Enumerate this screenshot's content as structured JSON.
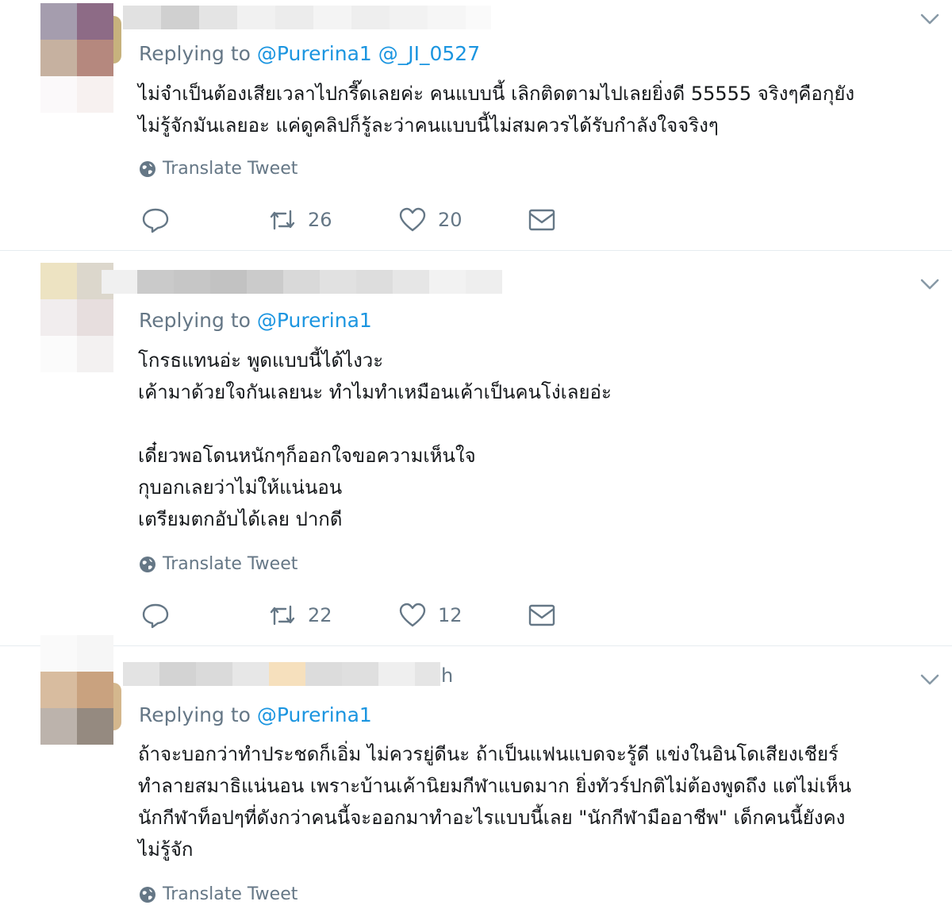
{
  "colors": {
    "link": "#1b95e0",
    "muted": "#657786",
    "text": "#14171a",
    "divider": "#e6ecf0"
  },
  "icons": {
    "more": "chevron-down-icon",
    "translate": "globe-icon",
    "reply": "reply-icon",
    "retweet": "retweet-icon",
    "like": "heart-icon",
    "dm": "envelope-icon"
  },
  "tweets": [
    {
      "replying_prefix": "Replying to",
      "mentions": [
        "@Purerina1",
        "@_JI_0527"
      ],
      "text": "ไม่จำเป็นต้องเสียเวลาไปกรี๊ดเลยค่ะ คนแบบนี้ เลิกติดตามไปเลยยิ่งดี 55555 จริงๆคือกุยัง\nไม่รู้จักมันเลยอะ แค่ดูคลิปก็รู้ละว่าคนแบบนี้ไม่สมควรได้รับกำลังใจจริงๆ",
      "translate_label": "Translate Tweet",
      "retweets": "26",
      "likes": "20"
    },
    {
      "replying_prefix": "Replying to",
      "mentions": [
        "@Purerina1"
      ],
      "text": "โกรธแทนอ่ะ พูดแบบนี้ได้ไงวะ\nเค้ามาด้วยใจกันเลยนะ ทำไมทำเหมือนเค้าเป็นคนโง่เลยอ่ะ\n\nเดี๋ยวพอโดนหนักๆก็ออกใจขอความเห็นใจ\nกุบอกเลยว่าไม่ให้แน่นอน\nเตรียมตกอับได้เลย ปากดี",
      "translate_label": "Translate Tweet",
      "retweets": "22",
      "likes": "12"
    },
    {
      "name_suffix": "h",
      "replying_prefix": "Replying to",
      "mentions": [
        "@Purerina1"
      ],
      "text": "ถ้าจะบอกว่าทำประชดก็เอิ่ม ไม่ควรยู่ดีนะ ถ้าเป็นแฟนแบดจะรู้ดี แข่งในอินโดเสียงเชียร์\nทำลายสมาธิแน่นอน เพราะบ้านเค้านิยมกีฬาแบดมาก ยิ่งทัวร์ปกติไม่ต้องพูดถึง แต่ไม่เห็น\nนักกีฬาท็อปๆที่ดังกว่าคนนี้จะออกมาทำอะไรแบบนี้เลย \"นักกีฬามืออาชีพ\" เด็กคนนี้ยังคง\nไม่รู้จัก",
      "translate_label": "Translate Tweet"
    }
  ]
}
